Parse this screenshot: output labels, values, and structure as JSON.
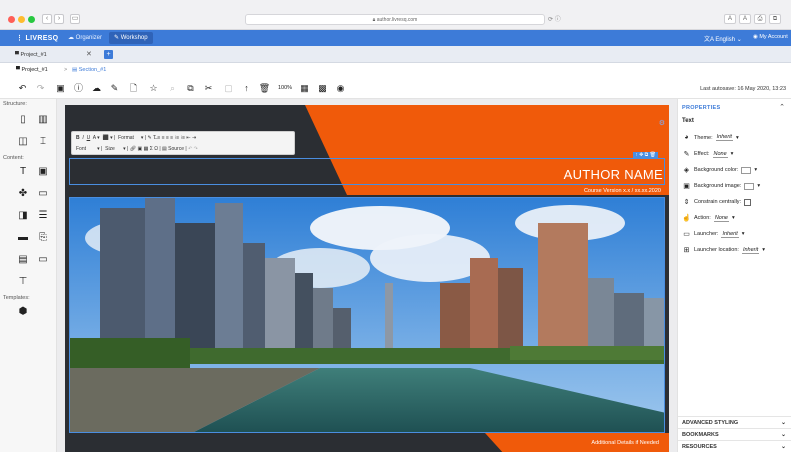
{
  "browser": {
    "url": "author.livresq.com",
    "right_buttons": [
      "A",
      "A",
      "⎙",
      "⧉"
    ]
  },
  "app": {
    "logo": "LIVRESQ",
    "nav": {
      "organizer": "Organizer",
      "workshop": "Workshop"
    },
    "language": "English",
    "account": "My Account"
  },
  "project_tab": {
    "label": "Project_#1",
    "close": "✕",
    "add": "+"
  },
  "breadcrumb": {
    "project": "Project_#1",
    "separator": ">",
    "section": "Section_#1"
  },
  "toolbar": {
    "zoom": "100%",
    "autosave": "Last autosave: 16 May 2020, 13:23"
  },
  "sidebar": {
    "structure_label": "Structure:",
    "content_label": "Content:",
    "templates_label": "Templates:"
  },
  "slide": {
    "text_toolbar": {
      "row1": [
        "B",
        "I",
        "U",
        "A ▾",
        "⬛ ▾",
        "Format",
        "▾"
      ],
      "font": "Font",
      "size": "Size",
      "source": "Source"
    },
    "author_name": "AUTHOR NAME",
    "course_version": "Course Version x.x / xx.xx.2020",
    "additional": "Additional Details if Needed",
    "accent_color": "#f05a0a",
    "dark_color": "#2b2e33"
  },
  "properties": {
    "header": "PROPERTIES",
    "title": "Text",
    "items": [
      {
        "label": "Theme:",
        "value": "Inherit"
      },
      {
        "label": "Effect:",
        "value": "None"
      },
      {
        "label": "Background color:",
        "value": ""
      },
      {
        "label": "Background image:",
        "value": ""
      },
      {
        "label": "Constrain centrally:",
        "value": ""
      },
      {
        "label": "Action:",
        "value": "None"
      },
      {
        "label": "Launcher:",
        "value": "Inherit"
      },
      {
        "label": "Launcher location:",
        "value": "Inherit"
      }
    ],
    "sections": [
      "ADVANCED STYLING",
      "BOOKMARKS",
      "RESOURCES"
    ]
  }
}
